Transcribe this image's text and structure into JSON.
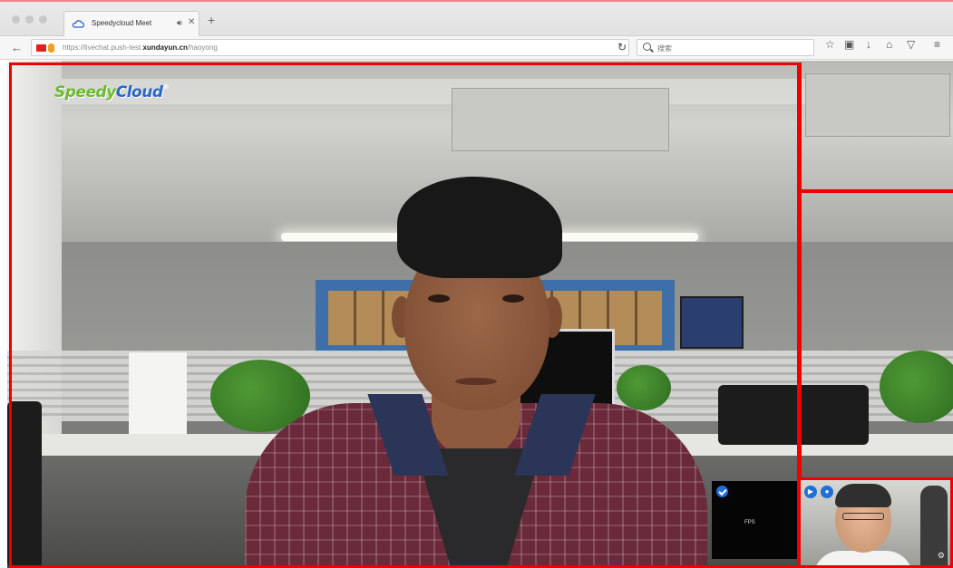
{
  "browser": {
    "tab": {
      "title": "Speedycloud Meet",
      "audio_icon": "speaker-icon",
      "close_icon": "close-icon"
    },
    "new_tab_icon": "plus-icon",
    "address": {
      "prefix": "https://livechat.push-test.",
      "domain": "xundayun.cn",
      "path": "/haoyong"
    },
    "search": {
      "placeholder": "搜索"
    },
    "toolbar_icons": [
      "star-icon",
      "reading-list-icon",
      "download-icon",
      "home-icon",
      "pocket-icon",
      "menu-icon"
    ]
  },
  "meeting": {
    "logo": {
      "part1": "Speedy",
      "part2": "Cloud",
      "mark": "®"
    },
    "local_preview": {
      "label": "FPS"
    },
    "remote_tile": {
      "controls": [
        "video-icon",
        "mic-icon"
      ]
    }
  },
  "colors": {
    "frame": "#ee0000",
    "accent_blue": "#1e6fd8",
    "logo_green": "#6dbb2c",
    "logo_blue": "#2a66c9"
  }
}
